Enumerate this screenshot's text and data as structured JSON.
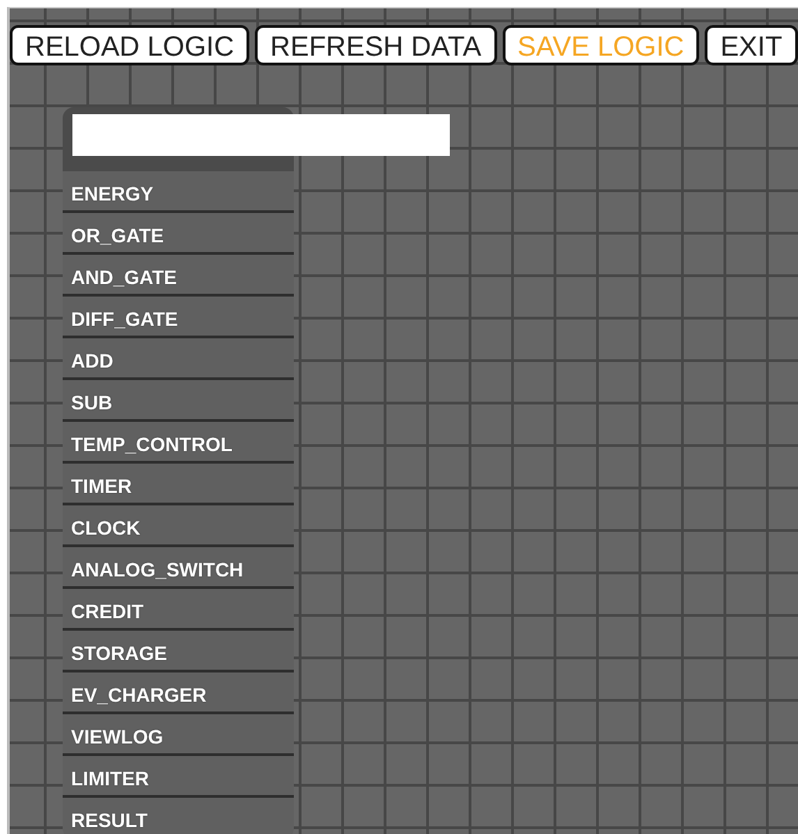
{
  "toolbar": [
    {
      "label": "RELOAD LOGIC",
      "color": "#222222"
    },
    {
      "label": "REFRESH DATA",
      "color": "#222222"
    },
    {
      "label": "SAVE LOGIC",
      "color": "#f5a623"
    },
    {
      "label": "EXIT",
      "color": "#222222"
    }
  ],
  "palette": {
    "items": [
      "ENERGY",
      "OR_GATE",
      "AND_GATE",
      "DIFF_GATE",
      "ADD",
      "SUB",
      "TEMP_CONTROL",
      "TIMER",
      "CLOCK",
      "ANALOG_SWITCH",
      "CREDIT",
      "STORAGE",
      "EV_CHARGER",
      "VIEWLOG",
      "LIMITER",
      "RESULT"
    ]
  }
}
